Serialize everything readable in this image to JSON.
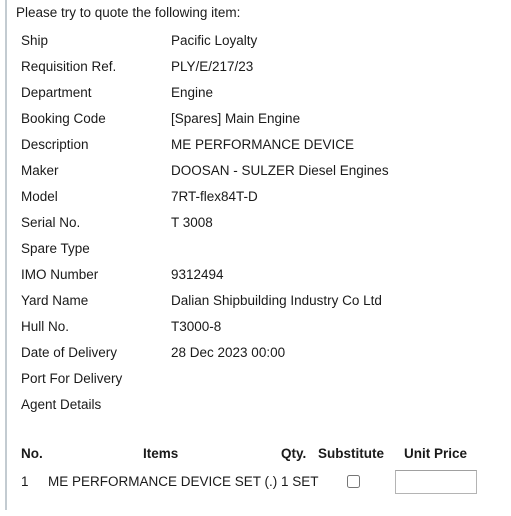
{
  "message": {
    "intro": "Please try to quote the following item:"
  },
  "details": [
    {
      "label": "Ship",
      "value": "Pacific Loyalty"
    },
    {
      "label": "Requisition Ref.",
      "value": "PLY/E/217/23"
    },
    {
      "label": "Department",
      "value": "Engine"
    },
    {
      "label": "Booking Code",
      "value": "[Spares] Main Engine"
    },
    {
      "label": "Description",
      "value": "ME PERFORMANCE DEVICE"
    },
    {
      "label": "Maker",
      "value": "DOOSAN - SULZER Diesel Engines"
    },
    {
      "label": "Model",
      "value": "7RT-flex84T-D"
    },
    {
      "label": "Serial No.",
      "value": "T 3008"
    },
    {
      "label": "Spare Type",
      "value": ""
    },
    {
      "label": "IMO Number",
      "value": "9312494"
    },
    {
      "label": "Yard Name",
      "value": "Dalian Shipbuilding Industry Co Ltd"
    },
    {
      "label": "Hull No.",
      "value": "T3000-8"
    },
    {
      "label": "Date of Delivery",
      "value": "28 Dec 2023 00:00"
    },
    {
      "label": "Port For Delivery",
      "value": ""
    },
    {
      "label": "Agent Details",
      "value": ""
    }
  ],
  "items_table": {
    "headers": {
      "no": "No.",
      "items": "Items",
      "qty": "Qty.",
      "substitute": "Substitute",
      "unit_price": "Unit Price"
    },
    "rows": [
      {
        "no": "1",
        "items": "ME PERFORMANCE DEVICE SET (.)",
        "qty": "1 SET",
        "substitute_checked": false,
        "unit_price_value": "",
        "unit_price_placeholder": ""
      }
    ]
  },
  "colors": {
    "quote_bar": "#c3cbd1",
    "text": "#1a1a1a",
    "input_border": "#b4b4b4",
    "checkbox_border": "#8e8e8e"
  }
}
